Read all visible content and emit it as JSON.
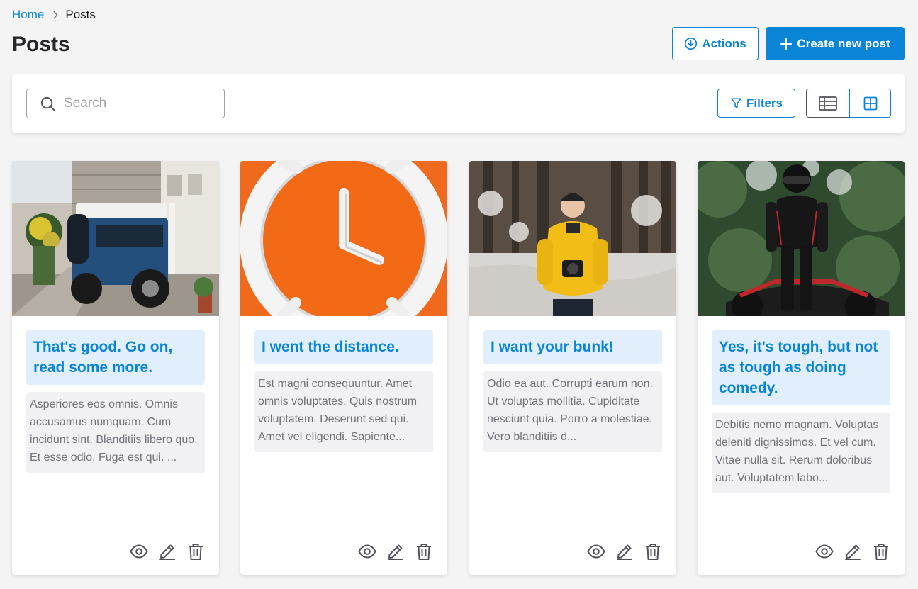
{
  "breadcrumb": {
    "home": "Home",
    "current": "Posts"
  },
  "page": {
    "title": "Posts"
  },
  "header": {
    "actions_label": "Actions",
    "create_label": "Create new post"
  },
  "toolbar": {
    "search_placeholder": "Search",
    "search_value": "",
    "filters_label": "Filters",
    "view_mode": "grid"
  },
  "colors": {
    "accent": "#0a84d6",
    "title_bg": "#e0effb",
    "body_bg": "#f1f1f3"
  },
  "posts": [
    {
      "title": "That's good. Go on, read some more.",
      "body": "Asperiores eos omnis. Omnis accusamus numquam. Cum incidunt sint. Blanditiis libero quo. Et esse odio. Fuga est qui. ...",
      "image": "blue-jeep-street-photo"
    },
    {
      "title": "I went the distance.",
      "body": "Est magni consequuntur. Amet omnis voluptates. Quis nostrum voluptatem. Deserunt sed qui. Amet vel eligendi. Sapiente...",
      "image": "orange-alarm-clock-photo"
    },
    {
      "title": "I want your bunk!",
      "body": "Odio ea aut. Corrupti earum non. Ut voluptas mollitia. Cupiditate nesciunt quia. Porro a molestiae. Vero blanditiis d...",
      "image": "man-yellow-jacket-forest-photo"
    },
    {
      "title": "Yes, it's tough, but not as tough as doing comedy.",
      "body": "Debitis nemo magnam. Voluptas deleniti dignissimos. Et vel cum. Vitae nulla sit. Rerum doloribus aut. Voluptatem labo...",
      "image": "motorcycle-rider-photo"
    }
  ]
}
